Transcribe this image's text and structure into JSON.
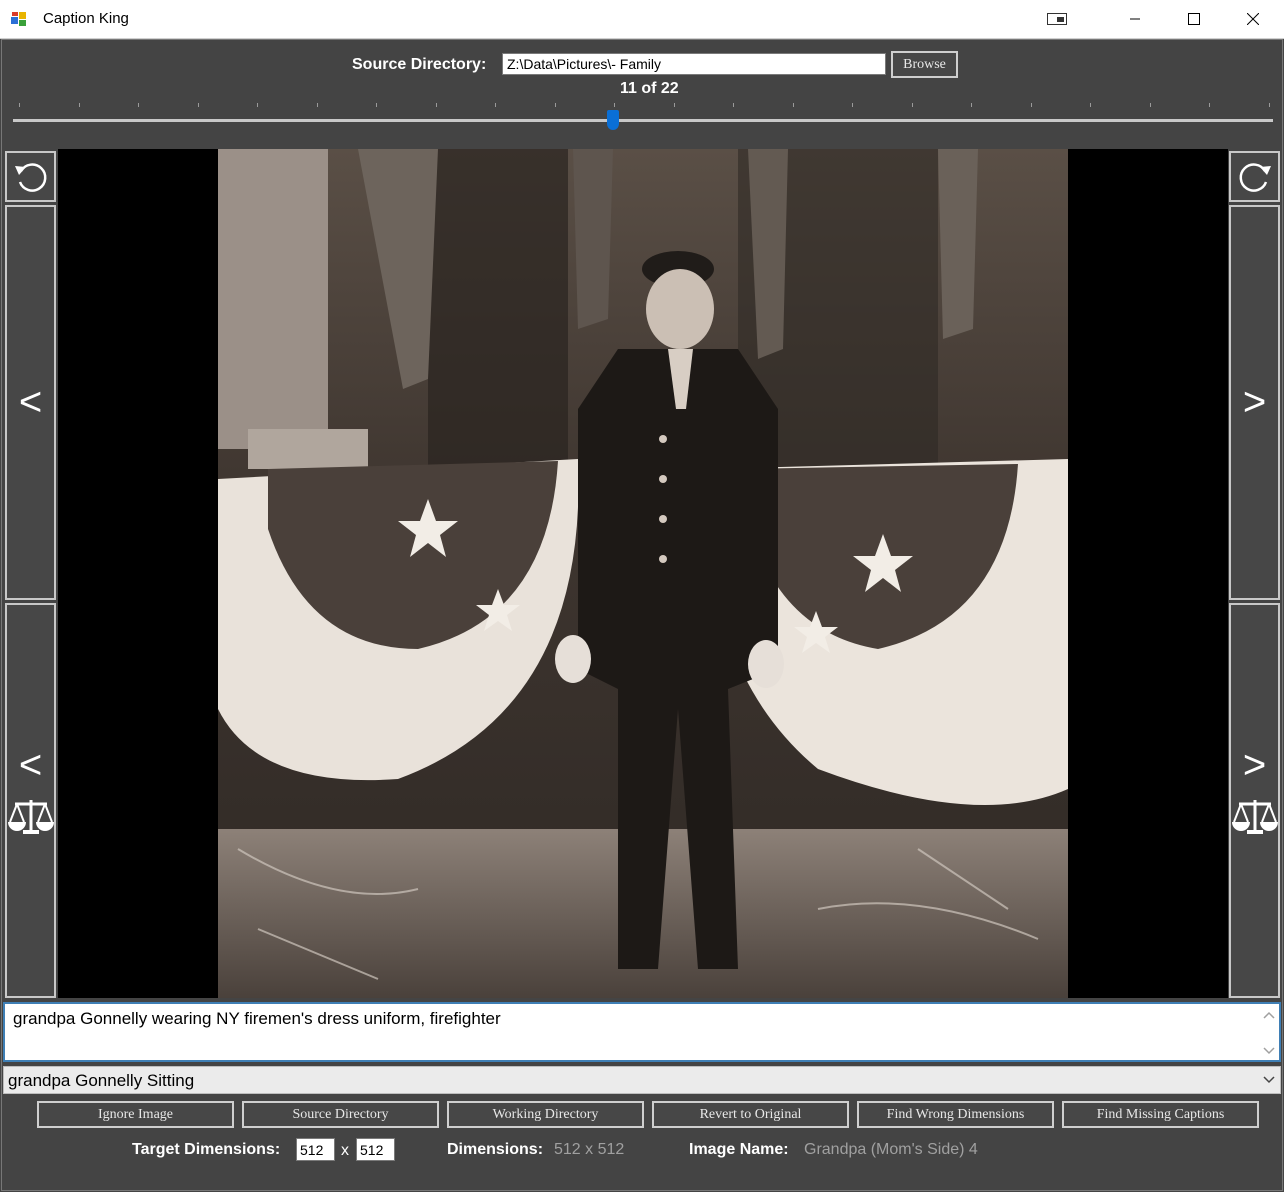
{
  "window": {
    "title": "Caption King"
  },
  "source": {
    "label": "Source Directory:",
    "path": "Z:\\Data\\Pictures\\- Family",
    "browse_label": "Browse"
  },
  "navigation": {
    "counter": "11 of 22",
    "current": 11,
    "total": 22,
    "slider_fraction": 0.4762
  },
  "side_buttons": {
    "prev_label": "<",
    "next_label": ">",
    "prev_compare_label": "<",
    "next_compare_label": ">"
  },
  "caption": {
    "text": "grandpa Gonnelly wearing NY firemen's dress uniform, firefighter"
  },
  "caption_suggestion": {
    "selected": "grandpa Gonnelly Sitting"
  },
  "actions": {
    "ignore": "Ignore Image",
    "source_dir": "Source Directory",
    "working_dir": "Working Directory",
    "revert": "Revert to Original",
    "find_wrong": "Find Wrong Dimensions",
    "find_missing": "Find Missing Captions"
  },
  "status": {
    "target_label": "Target Dimensions:",
    "target_width": "512",
    "x_sep": "x",
    "target_height": "512",
    "dimensions_label": "Dimensions:",
    "dimensions_value": "512 x 512",
    "image_name_label": "Image Name:",
    "image_name_value": "Grandpa (Mom's Side) 4"
  },
  "icons": {
    "app": "app-window-icon",
    "rotate_left": "rotate-ccw-icon",
    "rotate_right": "rotate-cw-icon",
    "compare": "scales-icon"
  },
  "colors": {
    "background": "#444444",
    "accent": "#0a6fd6",
    "button_border": "#cfcfcf"
  }
}
